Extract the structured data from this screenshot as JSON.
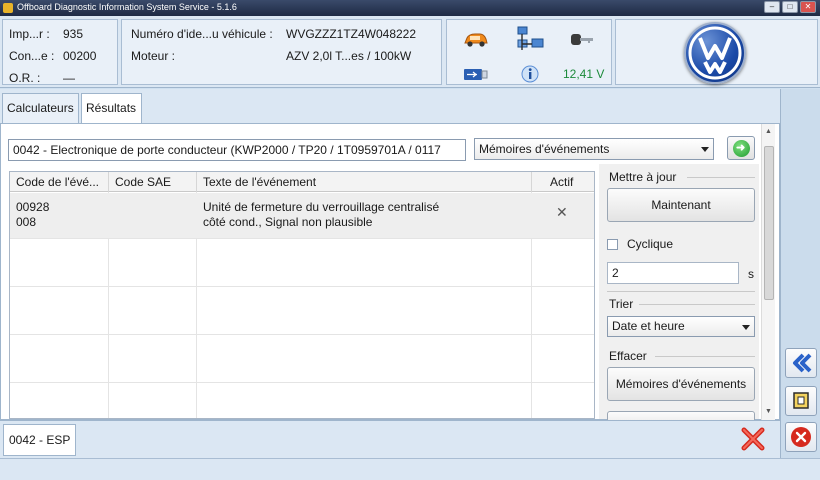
{
  "window": {
    "title": "Offboard Diagnostic Information System Service - 5.1.6",
    "controls": [
      "–",
      "□",
      "✕"
    ]
  },
  "header": {
    "left": [
      {
        "label": "Imp...r :",
        "value": "935"
      },
      {
        "label": "Con...e :",
        "value": "00200"
      },
      {
        "label": "O.R. :",
        "value": "—"
      }
    ],
    "vehicle": {
      "vin_label": "Numéro d'ide...u véhicule :",
      "vin_value": "WVGZZZ1TZ4W048222",
      "engine_label": "Moteur :",
      "engine_value": "AZV 2,0l T...es / 100kW"
    },
    "status_icons": [
      "car-icon",
      "network-icon",
      "key-icon",
      "usb-icon",
      "info-icon"
    ],
    "voltage": "12,41 V",
    "brand_logo": "vw-logo"
  },
  "tabs": [
    {
      "label": "Calculateurs",
      "active": false
    },
    {
      "label": "Résultats",
      "active": true
    }
  ],
  "main": {
    "ecu_field": "0042 - Electronique de porte conducteur  (KWP2000 / TP20 / 1T0959701A / 0117",
    "memory_select": "Mémoires d'événements",
    "go_icon": "go-arrow-icon"
  },
  "table": {
    "columns": [
      "Code de l'évé...",
      "Code SAE",
      "Texte de l'événement",
      "Actif"
    ],
    "rows": [
      {
        "code_line1": "00928",
        "code_line2": "008",
        "sae": "",
        "text_line1": "Unité de fermeture du verrouillage centralisé",
        "text_line2": "côté cond., Signal non plausible",
        "active": "✕"
      }
    ]
  },
  "side_panel": {
    "update_title": "Mettre à jour",
    "update_button": "Maintenant",
    "cyclic_label": "Cyclique",
    "cyclic_checked": false,
    "interval_value": "2",
    "interval_unit": "s",
    "sort_title": "Trier",
    "sort_value": "Date et heure",
    "clear_title": "Effacer",
    "clear_button": "Mémoires d'événements"
  },
  "bottom": {
    "tab_label": "0042 - ESP",
    "cancel_icon": "red-x-icon"
  },
  "rail_buttons": [
    "collapse-left-icon",
    "frame-icon",
    "close-circle-icon"
  ],
  "colors": {
    "voltage": "#1c8a3a",
    "accent_blue": "#2a62c9",
    "danger": "#d62a1e"
  }
}
